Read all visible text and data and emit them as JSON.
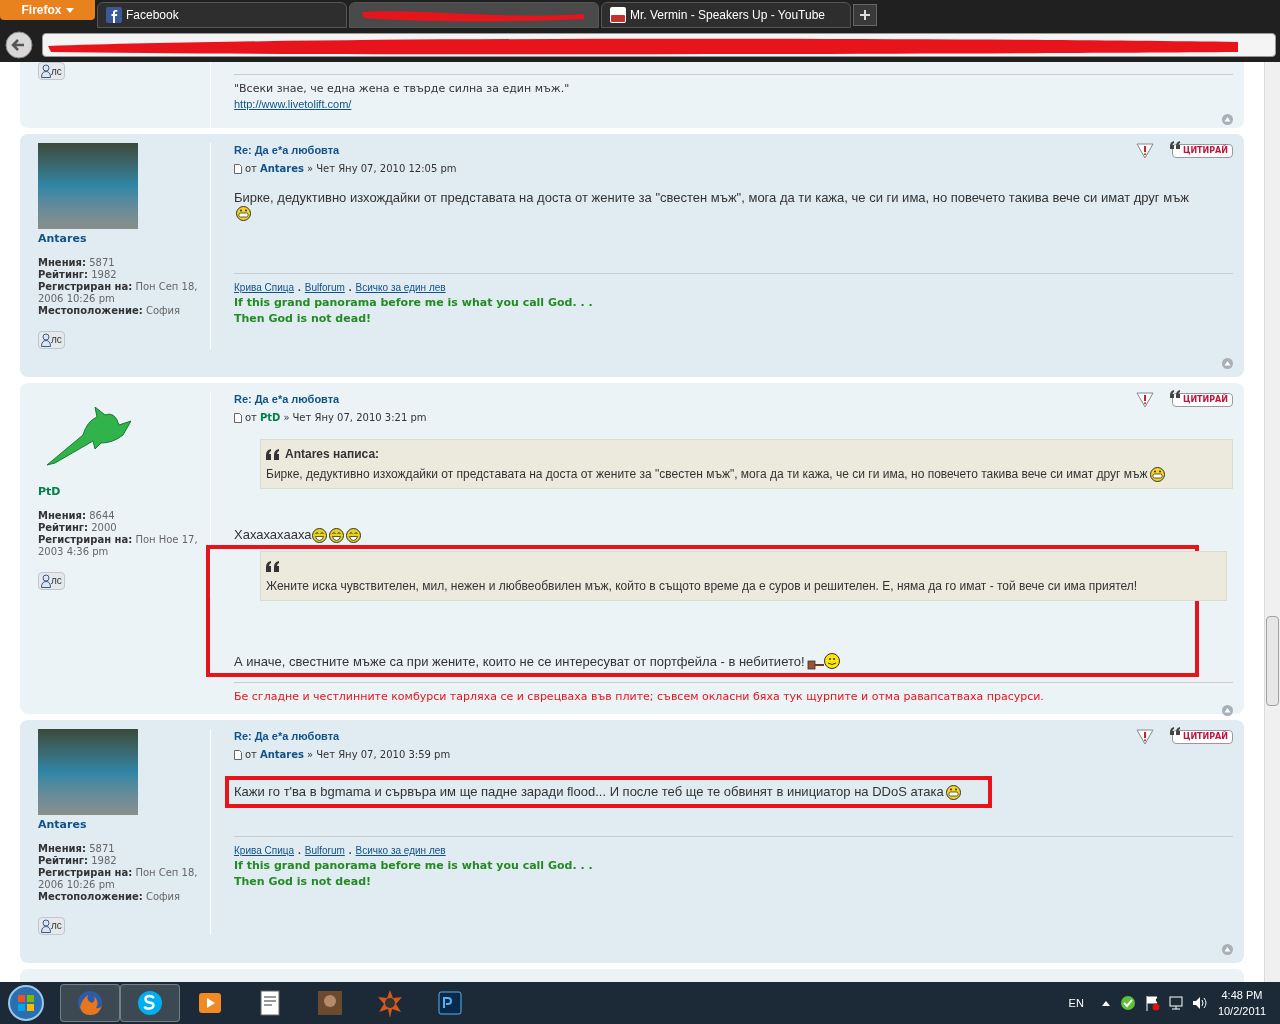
{
  "browser": {
    "menu_button": "Firefox",
    "tabs": [
      {
        "kind": "facebook",
        "label": "Facebook",
        "selected": false
      },
      {
        "kind": "redacted",
        "selected": true
      },
      {
        "kind": "youtube",
        "label": "Mr. Vermin - Speakers Up - YouTube",
        "selected": false
      }
    ]
  },
  "posts": [
    {
      "kind": "partial",
      "pm_label": "лс",
      "signature": {
        "kind": "plain",
        "lines": [
          "\"Всеки знае, че една жена е твърде силна за един мъж.\""
        ],
        "link": "http://www.livetolift.com/"
      }
    },
    {
      "kind": "full",
      "avatar": {
        "kind": "photo"
      },
      "profile_name": {
        "text": "Antares",
        "color": "#105289"
      },
      "title": "Re: Да е*а любовта",
      "by": "от",
      "author": {
        "text": "Antares",
        "color": "#105289"
      },
      "separator": "»",
      "date": "Чет Яну 07, 2010 12:05 pm",
      "quote_button": "ЦИТИРАЙ",
      "pm_label": "лс",
      "stats": [
        {
          "label": "Мнения:",
          "value": "5871"
        },
        {
          "label": "Рейтинг:",
          "value": "1982"
        },
        {
          "label": "Регистриран на:",
          "value": "Пон Сеп 18, 2006 10:26 pm"
        },
        {
          "label": "Местоположение:",
          "value": "София"
        }
      ],
      "blocks": [
        {
          "kind": "text",
          "text": "Бирке, дедуктивно изхождайки от представата на доста от жените за \"свестен мъж\", мога да ти кажа, че си ги има, но повечето такива вече си имат друг мъж",
          "smileys": [
            {
              "kind": "grin"
            }
          ],
          "highlighted": false
        }
      ],
      "signature": {
        "kind": "motto",
        "links": [
          "Крива Спица",
          "Bulforum",
          "Всичко за един лев"
        ],
        "link_separator": ".",
        "lines": [
          "If this grand panorama before me is what you call God. . .",
          "Then God is not dead!"
        ]
      }
    },
    {
      "kind": "full",
      "avatar": {
        "kind": "shark"
      },
      "profile_name": {
        "text": "PtD",
        "color": "#00804a"
      },
      "title": "Re: Да е*а любовта",
      "by": "от",
      "author": {
        "text": "PtD",
        "color": "#00804a"
      },
      "separator": "»",
      "date": "Чет Яну 07, 2010 3:21 pm",
      "quote_button": "ЦИТИРАЙ",
      "pm_label": "лс",
      "stats": [
        {
          "label": "Мнения:",
          "value": "8644"
        },
        {
          "label": "Рейтинг:",
          "value": "2000"
        },
        {
          "label": "Регистриран на:",
          "value": "Пон Ное 17, 2003 4:36 pm"
        }
      ],
      "blocks": [
        {
          "kind": "quote",
          "cite": "Antares написа:",
          "text": "Бирке, дедуктивно изхождайки от представата на доста от жените за \"свестен мъж\", мога да ти кажа, че си ги има, но повечето такива вече си имат друг мъж",
          "smileys": [
            {
              "kind": "grin"
            }
          ],
          "highlighted": false
        },
        {
          "kind": "text",
          "text": "Хахахахааха",
          "smileys": [
            {
              "kind": "laugh"
            },
            {
              "kind": "laugh"
            },
            {
              "kind": "laugh"
            }
          ],
          "highlighted": false
        },
        {
          "kind": "quote",
          "text": "Жените иска чувствителен, мил, нежен и любвеобвилен мъж, който в същото време да е суров и решителен. Е, няма да го имат - той вече си има приятел!",
          "highlighted": true
        },
        {
          "kind": "text",
          "text": "А иначе, свестните мъже са при жените, които не се интересуват от портфейла - в небитието!",
          "smileys": [
            {
              "kind": "hammer"
            }
          ],
          "highlighted": true
        }
      ],
      "signature": {
        "kind": "verse",
        "lines": [
          "Бе сгладне и честлинните комбурси тарляха се и сврецваха във плите; съвсем окласни бяха тук щурпите и отма равапсатваха прасурси."
        ]
      }
    },
    {
      "kind": "full",
      "avatar": {
        "kind": "photo"
      },
      "profile_name": {
        "text": "Antares",
        "color": "#105289"
      },
      "title": "Re: Да е*а любовта",
      "by": "от",
      "author": {
        "text": "Antares",
        "color": "#105289"
      },
      "separator": "»",
      "date": "Чет Яну 07, 2010 3:59 pm",
      "quote_button": "ЦИТИРАЙ",
      "pm_label": "лс",
      "stats": [
        {
          "label": "Мнения:",
          "value": "5871"
        },
        {
          "label": "Рейтинг:",
          "value": "1982"
        },
        {
          "label": "Регистриран на:",
          "value": "Пон Сеп 18, 2006 10:26 pm"
        },
        {
          "label": "Местоположение:",
          "value": "София"
        }
      ],
      "blocks": [
        {
          "kind": "text",
          "text": "Кажи го т'ва в bgmama и сървъра им ще падне заради flood... И после теб ще те обвинят в инициатор на DDoS атака",
          "smileys": [
            {
              "kind": "grin"
            }
          ],
          "highlighted": true
        }
      ],
      "signature": {
        "kind": "motto",
        "links": [
          "Крива Спица",
          "Bulforum",
          "Всичко за един лев"
        ],
        "link_separator": ".",
        "lines": [
          "If this grand panorama before me is what you call God. . .",
          "Then God is not dead!"
        ]
      }
    },
    {
      "kind": "edge"
    }
  ],
  "taskbar": {
    "apps": [
      {
        "kind": "firefox"
      },
      {
        "kind": "skype"
      },
      {
        "kind": "media-player"
      },
      {
        "kind": "document"
      },
      {
        "kind": "portrait"
      },
      {
        "kind": "game"
      },
      {
        "kind": "photoshop"
      }
    ],
    "language": "EN",
    "time": "4:48 PM",
    "date": "10/2/2011"
  }
}
